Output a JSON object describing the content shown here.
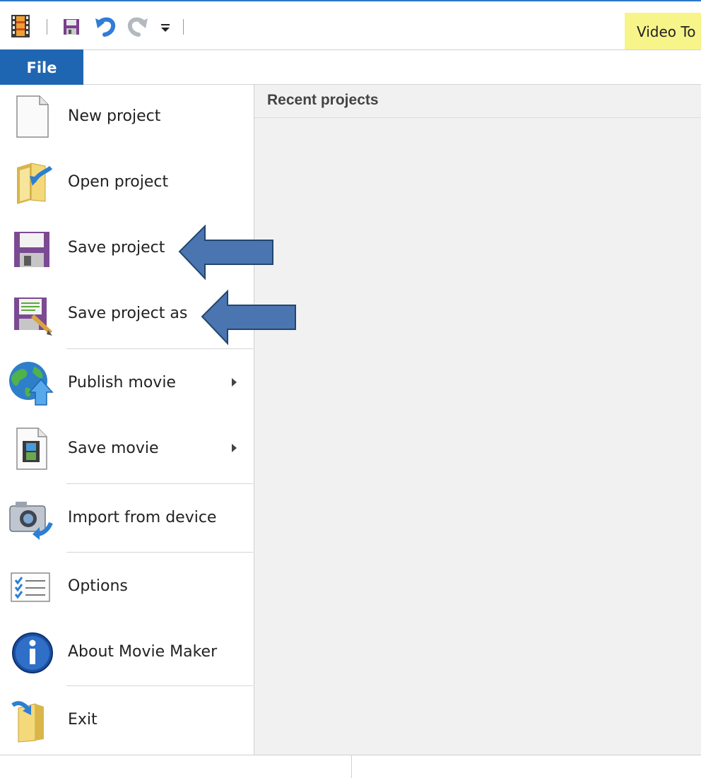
{
  "qat": {
    "icons": [
      "movie-maker-app-icon",
      "save-icon",
      "undo-icon",
      "redo-icon",
      "customize-dropdown-icon"
    ]
  },
  "ribbon": {
    "file_tab": "File",
    "contextual_tab": "Video To"
  },
  "file_menu": {
    "items": [
      {
        "label": "New project",
        "icon": "new-project-icon"
      },
      {
        "label": "Open project",
        "icon": "open-folder-icon"
      },
      {
        "label": "Save project",
        "icon": "floppy-disk-icon"
      },
      {
        "label": "Save project as",
        "icon": "save-as-icon"
      },
      {
        "label": "Publish movie",
        "icon": "globe-publish-icon",
        "submenu": true
      },
      {
        "label": "Save movie",
        "icon": "save-movie-icon",
        "submenu": true
      },
      {
        "label": "Import from device",
        "icon": "camera-import-icon"
      },
      {
        "label": "Options",
        "icon": "options-checklist-icon"
      },
      {
        "label": "About Movie Maker",
        "icon": "info-icon"
      },
      {
        "label": "Exit",
        "icon": "exit-icon"
      }
    ]
  },
  "recent": {
    "title": "Recent projects"
  },
  "colors": {
    "accent": "#1f66b2",
    "callout_arrow": "#4a75b0",
    "contextual_tab_bg": "#f7f48a"
  }
}
